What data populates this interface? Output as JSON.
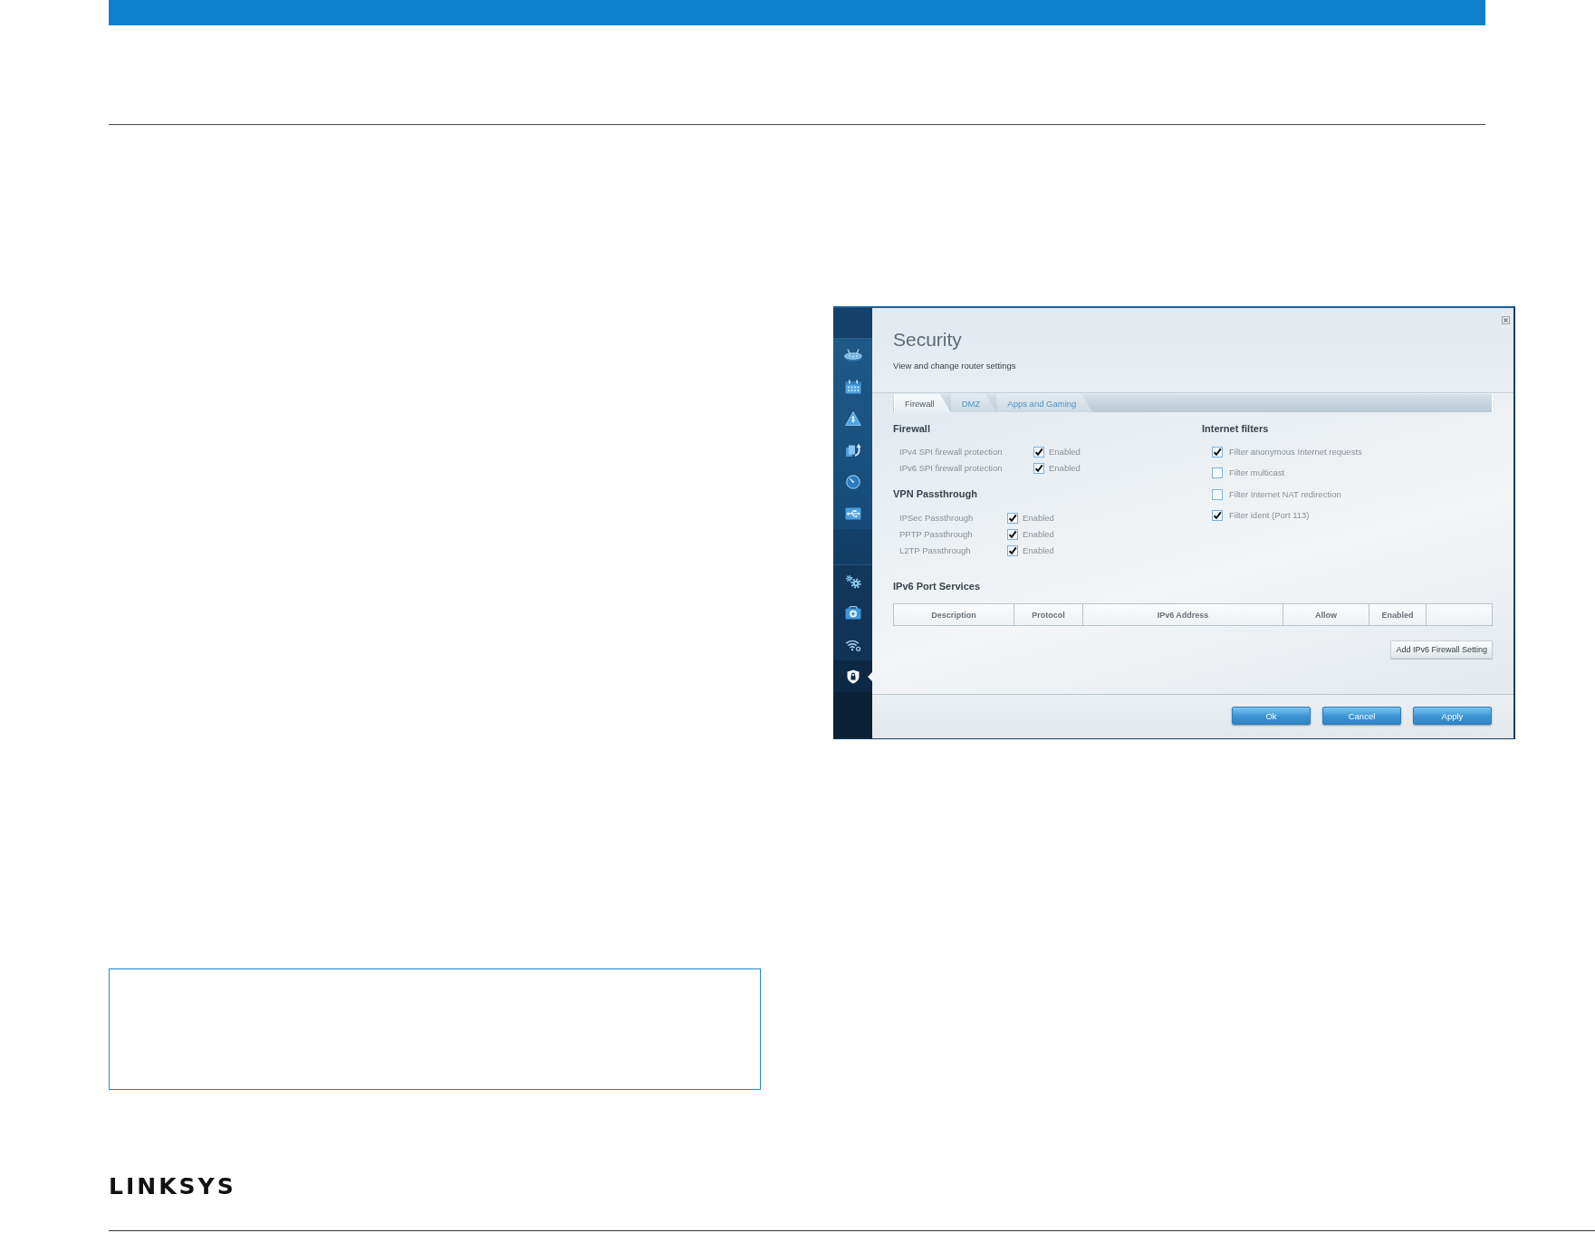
{
  "page": {
    "logo": "LINKSYS"
  },
  "router_window": {
    "sidebar": {
      "groups": [
        {
          "items": [
            {
              "selected": false
            },
            {
              "selected": false
            },
            {
              "selected": false
            },
            {
              "selected": false
            },
            {
              "selected": false
            },
            {
              "selected": false
            }
          ]
        },
        {
          "items": [
            {
              "selected": false
            },
            {
              "selected": false
            },
            {
              "selected": false
            },
            {
              "selected": true
            }
          ]
        }
      ]
    },
    "title": "Security",
    "subtitle": "View and change router settings",
    "tabs": [
      {
        "label": "Firewall",
        "selected": true
      },
      {
        "label": "DMZ",
        "selected": false
      },
      {
        "label": "Apps and Gaming",
        "selected": false
      }
    ],
    "firewall": {
      "heading": "Firewall",
      "rows": [
        {
          "label": "IPv4 SPI firewall protection",
          "checked": true,
          "option": "Enabled"
        },
        {
          "label": "IPv6 SPI firewall protection",
          "checked": true,
          "option": "Enabled"
        }
      ]
    },
    "vpn_passthrough": {
      "heading": "VPN Passthrough",
      "rows": [
        {
          "label": "IPSec Passthrough",
          "checked": true,
          "option": "Enabled"
        },
        {
          "label": "PPTP Passthrough",
          "checked": true,
          "option": "Enabled"
        },
        {
          "label": "L2TP Passthrough",
          "checked": true,
          "option": "Enabled"
        }
      ]
    },
    "internet_filters": {
      "heading": "Internet filters",
      "rows": [
        {
          "label": "Filter anonymous Internet requests",
          "checked": true
        },
        {
          "label": "Filter multicast",
          "checked": false
        },
        {
          "label": "Filter Internet NAT redirection",
          "checked": false
        },
        {
          "label": "Filter ident (Port 113)",
          "checked": true
        }
      ]
    },
    "ipv6_port_services": {
      "heading": "IPv6 Port Services",
      "columns": [
        "Description",
        "Protocol",
        "IPv6 Address",
        "Allow",
        "Enabled"
      ],
      "add_button": "Add IPv6 Firewall Setting"
    },
    "buttons": [
      "Ok",
      "Cancel",
      "Apply"
    ]
  }
}
